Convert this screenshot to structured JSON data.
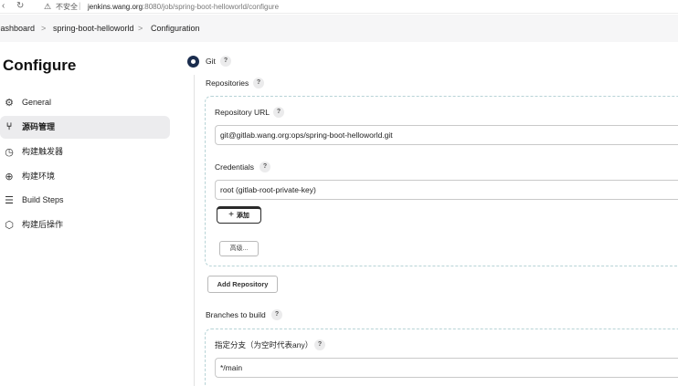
{
  "browser": {
    "nav_chevron": "‹",
    "reload_icon": "↻",
    "warning_icon": "⚠",
    "insecure_label": "不安全",
    "url_host": "jenkins.wang.org",
    "url_rest": ":8080/job/spring-boot-helloworld/configure"
  },
  "breadcrumb": {
    "items": [
      "Dashboard",
      "spring-boot-helloworld",
      "Configuration"
    ],
    "separator": ">"
  },
  "sidebar": {
    "title": "Configure",
    "items": [
      {
        "label": "General",
        "icon": "gear-icon",
        "glyph": "⚙",
        "active": false
      },
      {
        "label": "源码管理",
        "icon": "branch-icon",
        "glyph": "⑂",
        "active": true
      },
      {
        "label": "构建触发器",
        "icon": "clock-icon",
        "glyph": "◷",
        "active": false
      },
      {
        "label": "构建环境",
        "icon": "globe-icon",
        "glyph": "⊕",
        "active": false
      },
      {
        "label": "Build Steps",
        "icon": "list-icon",
        "glyph": "☰",
        "active": false
      },
      {
        "label": "构建后操作",
        "icon": "package-icon",
        "glyph": "⬡",
        "active": false
      }
    ]
  },
  "main": {
    "scm_option": "Git",
    "help_glyph": "?",
    "repositories_label": "Repositories",
    "repository_url_label": "Repository URL",
    "repository_url_value": "git@gitlab.wang.org:ops/spring-boot-helloworld.git",
    "credentials_label": "Credentials",
    "credentials_value": "root (gitlab-root-private-key)",
    "add_button": {
      "plus": "+",
      "label": "添加"
    },
    "advanced_button": "高级...",
    "add_repository_button": "Add Repository",
    "branches_label": "Branches to build",
    "branch_specifier_label": "指定分支（为空时代表any）",
    "branch_specifier_value": "*/main"
  },
  "colors": {
    "accent": "#1b2d4e",
    "panel_border": "#b7d3d6",
    "active_sidebar_bg": "#ececee"
  }
}
